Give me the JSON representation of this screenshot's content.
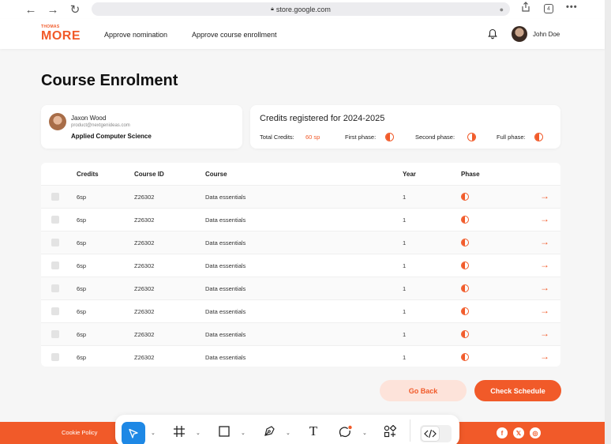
{
  "browser": {
    "url": "store.google.com",
    "tab_count": "4"
  },
  "header": {
    "logo_small": "THOMAS",
    "logo_big": "MORE",
    "links": [
      "Approve nomination",
      "Approve course enrollment"
    ],
    "user_name": "John Doe"
  },
  "page_title": "Course Enrolment",
  "student": {
    "name": "Jaxon Wood",
    "email": "product@nextgenideas.com",
    "program": "Applied Computer Science"
  },
  "credits": {
    "title": "Credits registered for 2024-2025",
    "total_label": "Total Credits:",
    "total_value": "60 sp",
    "first_label": "First phase:",
    "second_label": "Second phase:",
    "full_label": "Full phase:",
    "first_fill": 0.5,
    "second_fill": 0.5,
    "full_fill": 0.5
  },
  "table": {
    "headers": [
      "Credits",
      "Course ID",
      "Course",
      "Year",
      "Phase"
    ],
    "rows": [
      {
        "credits": "6sp",
        "course_id": "Z26302",
        "course": "Data essentials",
        "year": "1",
        "phase_fill": 0.5
      },
      {
        "credits": "6sp",
        "course_id": "Z26302",
        "course": "Data essentials",
        "year": "1",
        "phase_fill": 0.5
      },
      {
        "credits": "6sp",
        "course_id": "Z26302",
        "course": "Data essentials",
        "year": "1",
        "phase_fill": 0.5
      },
      {
        "credits": "6sp",
        "course_id": "Z26302",
        "course": "Data essentials",
        "year": "1",
        "phase_fill": 0.5
      },
      {
        "credits": "6sp",
        "course_id": "Z26302",
        "course": "Data essentials",
        "year": "1",
        "phase_fill": 0.5
      },
      {
        "credits": "6sp",
        "course_id": "Z26302",
        "course": "Data essentials",
        "year": "1",
        "phase_fill": 0.5
      },
      {
        "credits": "6sp",
        "course_id": "Z26302",
        "course": "Data essentials",
        "year": "1",
        "phase_fill": 0.5
      },
      {
        "credits": "6sp",
        "course_id": "Z26302",
        "course": "Data essentials",
        "year": "1",
        "phase_fill": 0.5
      }
    ]
  },
  "actions": {
    "back_label": "Go Back",
    "check_label": "Check Schedule"
  },
  "footer": {
    "cookie_label": "Cookie Policy",
    "socials": [
      "facebook-icon",
      "x-icon",
      "instagram-icon"
    ]
  },
  "toolbar": {
    "tools": [
      "select-tool",
      "frame-tool",
      "rectangle-tool",
      "pen-tool",
      "text-tool",
      "comment-tool",
      "components-tool",
      "code-tool"
    ]
  },
  "colors": {
    "accent": "#f15a29",
    "accent_light": "#fde3da",
    "toolbar_active": "#1e88e5"
  }
}
